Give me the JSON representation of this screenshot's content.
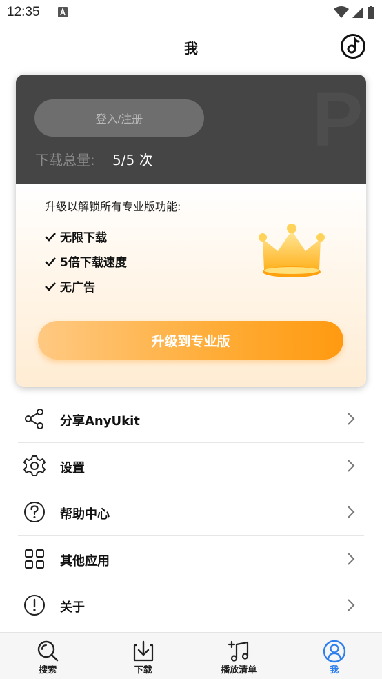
{
  "status_bar": {
    "time": "12:35"
  },
  "header": {
    "title": "我"
  },
  "card": {
    "login_label": "登入/注册",
    "download_total_label": "下载总量:",
    "download_total_value": "5/5 次",
    "upgrade_intro": "升级以解锁所有专业版功能:",
    "features": [
      "无限下载",
      "5倍下载速度",
      "无广告"
    ],
    "upgrade_button": "升级到专业版"
  },
  "menu": {
    "items": [
      {
        "label": "分享AnyUkit",
        "icon": "share-icon"
      },
      {
        "label": "设置",
        "icon": "gear-icon"
      },
      {
        "label": "帮助中心",
        "icon": "help-icon"
      },
      {
        "label": "其他应用",
        "icon": "grid-icon"
      },
      {
        "label": "关于",
        "icon": "info-icon"
      }
    ]
  },
  "bottom_nav": {
    "items": [
      {
        "label": "搜索",
        "icon": "search-icon"
      },
      {
        "label": "下载",
        "icon": "download-icon"
      },
      {
        "label": "播放清单",
        "icon": "playlist-icon"
      },
      {
        "label": "我",
        "icon": "user-icon",
        "active": true
      }
    ]
  },
  "colors": {
    "accent": "#2f80ed",
    "upgrade_orange": "#ffa21f",
    "card_dark": "#454545"
  }
}
